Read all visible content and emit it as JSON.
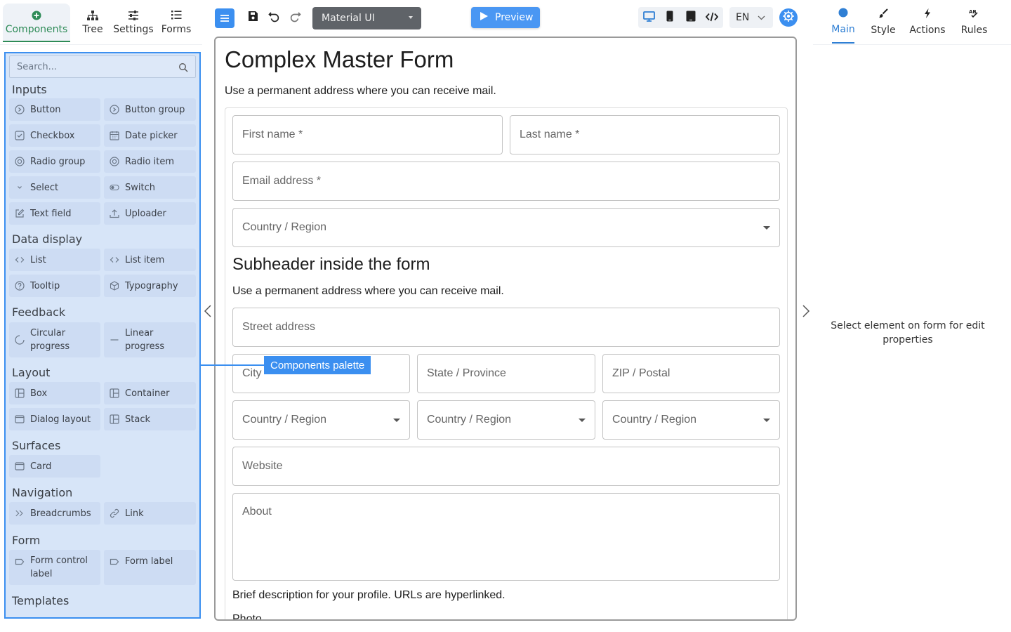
{
  "left_tabs": [
    {
      "label": "Components",
      "icon": "plus-circle-icon",
      "active": true
    },
    {
      "label": "Tree",
      "icon": "sitemap-icon"
    },
    {
      "label": "Settings",
      "icon": "sliders-icon"
    },
    {
      "label": "Forms",
      "icon": "list-icon"
    }
  ],
  "palette": {
    "search_placeholder": "Search...",
    "sections": {
      "inputs": "Inputs",
      "data_display": "Data display",
      "feedback": "Feedback",
      "layout": "Layout",
      "surfaces": "Surfaces",
      "navigation": "Navigation",
      "form": "Form",
      "templates": "Templates"
    },
    "items": {
      "button": "Button",
      "button_group": "Button group",
      "checkbox": "Checkbox",
      "date_picker": "Date picker",
      "radio_group": "Radio group",
      "radio_item": "Radio item",
      "select": "Select",
      "switch": "Switch",
      "text_field": "Text field",
      "uploader": "Uploader",
      "list": "List",
      "list_item": "List item",
      "tooltip": "Tooltip",
      "typography": "Typography",
      "circular_progress_1": "Circular",
      "circular_progress_2": "progress",
      "linear_progress_1": "Linear",
      "linear_progress_2": "progress",
      "box": "Box",
      "container": "Container",
      "dialog_layout": "Dialog layout",
      "stack": "Stack",
      "card": "Card",
      "breadcrumbs": "Breadcrumbs",
      "link": "Link",
      "form_control_label_1": "Form control",
      "form_control_label_2": "label",
      "form_label": "Form label"
    }
  },
  "toolbar": {
    "theme": "Material UI",
    "preview_label": "Preview",
    "language": "EN"
  },
  "form": {
    "title": "Complex Master Form",
    "description": "Use a permanent address where you can receive mail.",
    "first_name": "First name *",
    "last_name": "Last name *",
    "email": "Email address *",
    "country": "Country / Region",
    "subheader": "Subheader inside the form",
    "sub_description": "Use a permanent address where you can receive mail.",
    "street": "Street address",
    "city": "City",
    "state": "State / Province",
    "zip": "ZIP / Postal",
    "website": "Website",
    "about": "About",
    "about_helper": "Brief description for your profile. URLs are hyperlinked.",
    "photo": "Photo"
  },
  "annotation": {
    "label": "Components palette",
    "color": "#3b8ff0"
  },
  "right_tabs": [
    {
      "label": "Main",
      "icon": "circle-icon",
      "active": true
    },
    {
      "label": "Style",
      "icon": "brush-icon"
    },
    {
      "label": "Actions",
      "icon": "bolt-icon"
    },
    {
      "label": "Rules",
      "icon": "ab-rules-icon"
    }
  ],
  "right_panel": {
    "hint": "Select element on form for edit properties"
  },
  "colors": {
    "accent": "#3b8ff0",
    "components_active": "#2e8b57",
    "main_active": "#2f7fd4",
    "palette_bg": "#d7e5f8"
  }
}
